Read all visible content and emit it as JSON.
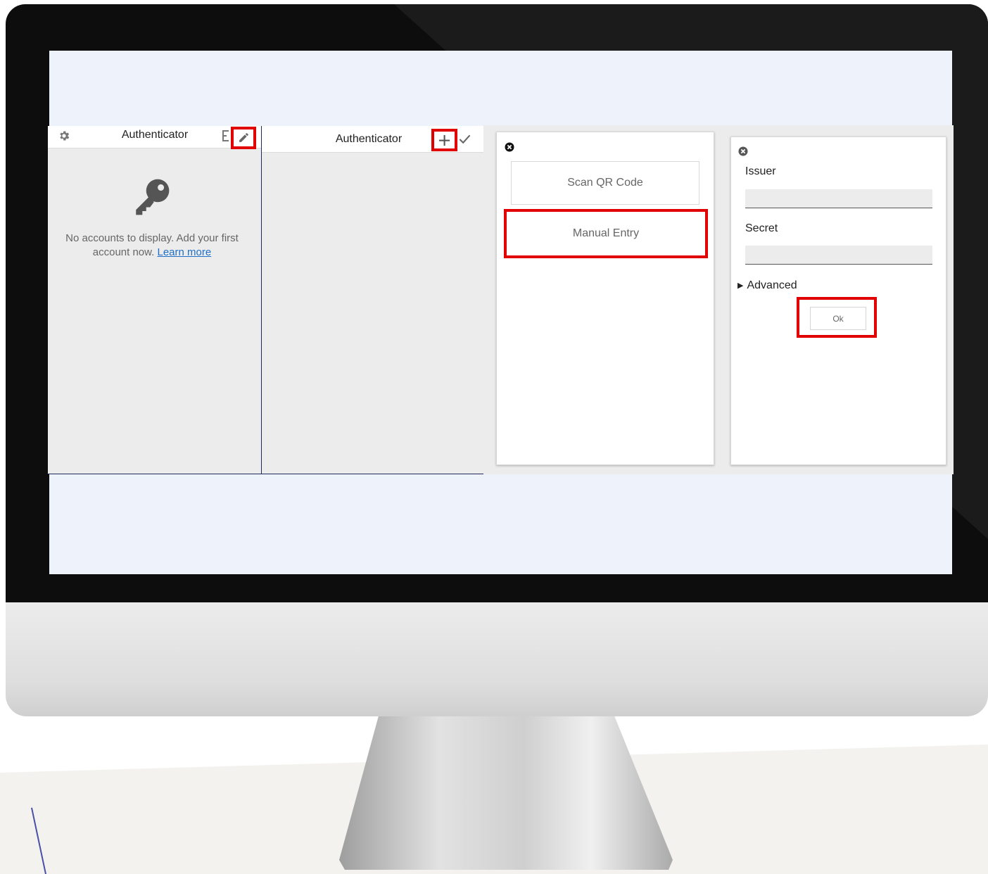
{
  "colors": {
    "highlight": "#e00000",
    "link": "#1e6fc5",
    "screen_background": "#eef3fb",
    "panel_background": "#ececec"
  },
  "panel_list": {
    "title": "Authenticator",
    "settings_icon": "gear-icon",
    "edit_icon": "pencil-icon",
    "empty_icon": "key-icon",
    "empty_message": "No accounts to display. Add your first account now.",
    "learn_more": "Learn more"
  },
  "panel_edit": {
    "title": "Authenticator",
    "add_icon": "plus-icon",
    "done_icon": "check-icon"
  },
  "dialog_add": {
    "close_icon": "close-icon",
    "scan_qr": "Scan QR Code",
    "manual_entry": "Manual Entry"
  },
  "dialog_manual": {
    "close_icon": "close-icon",
    "issuer_label": "Issuer",
    "issuer_value": "",
    "secret_label": "Secret",
    "secret_value": "",
    "advanced": "Advanced",
    "ok": "Ok"
  }
}
